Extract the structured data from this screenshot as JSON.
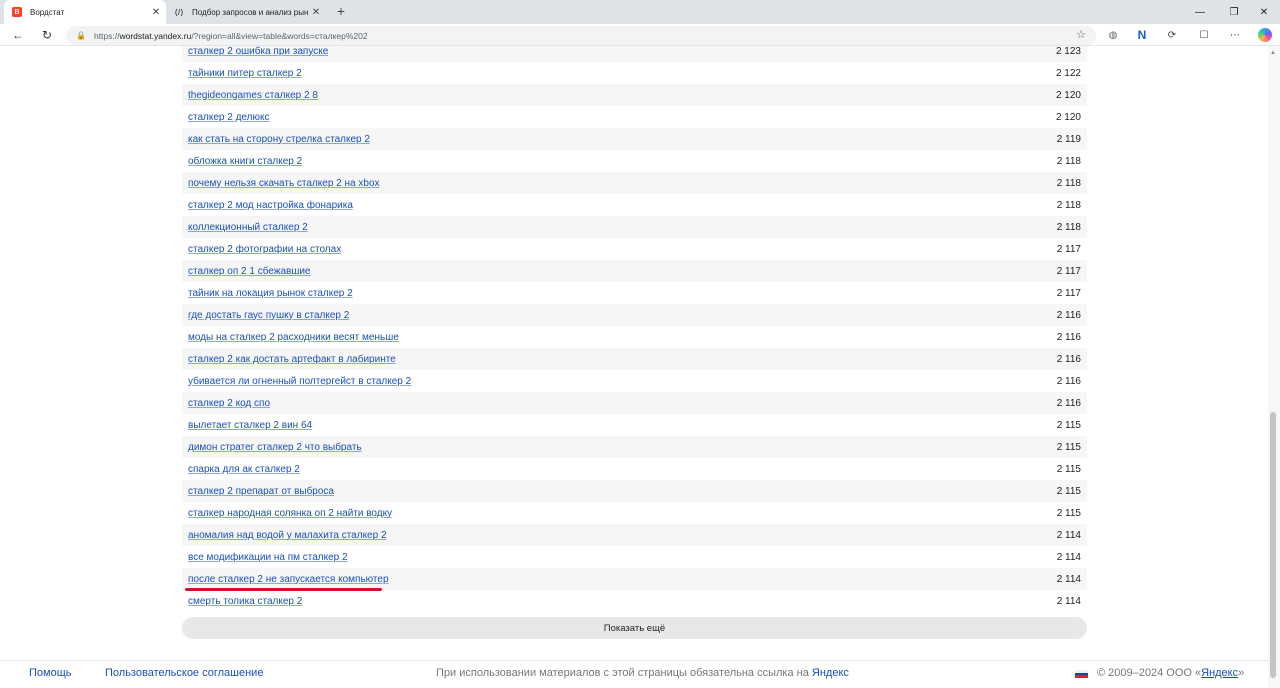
{
  "browser": {
    "tabs": [
      {
        "title": "Вордстат",
        "active": true
      },
      {
        "title": "Подбор запросов и анализ рын"
      }
    ],
    "url_prefix": "https://",
    "url_host": "wordstat.yandex.ru",
    "url_rest": "/?region=all&view=table&words=сталкер%202"
  },
  "rows": [
    {
      "query": "сталкер 2 ошибка при запуске",
      "count": "2 123"
    },
    {
      "query": "тайники питер сталкер 2",
      "count": "2 122"
    },
    {
      "query": "thegideongames сталкер 2 8",
      "count": "2 120"
    },
    {
      "query": "сталкер 2 делюкс",
      "count": "2 120"
    },
    {
      "query": "как стать на сторону стрелка сталкер 2",
      "count": "2 119"
    },
    {
      "query": "обложка книги сталкер 2",
      "count": "2 118"
    },
    {
      "query": "почему нельзя скачать сталкер 2 на xbox",
      "count": "2 118"
    },
    {
      "query": "сталкер 2 мод настройка фонарика",
      "count": "2 118"
    },
    {
      "query": "коллекционный сталкер 2",
      "count": "2 118"
    },
    {
      "query": "сталкер 2 фотографии на столах",
      "count": "2 117"
    },
    {
      "query": "сталкер оп 2 1 сбежавшие",
      "count": "2 117"
    },
    {
      "query": "тайник на локация рынок сталкер 2",
      "count": "2 117"
    },
    {
      "query": "где достать гаус пушку в сталкер 2",
      "count": "2 116"
    },
    {
      "query": "моды на сталкер 2 расходники весят меньше",
      "count": "2 116"
    },
    {
      "query": "сталкер 2 как достать артефакт в лабиринте",
      "count": "2 116"
    },
    {
      "query": "убивается ли огненный полтергейст в сталкер 2",
      "count": "2 116"
    },
    {
      "query": "сталкер 2 код спо",
      "count": "2 116"
    },
    {
      "query": "вылетает сталкер 2 вин 64",
      "count": "2 115"
    },
    {
      "query": "димон стратег сталкер 2 что выбрать",
      "count": "2 115"
    },
    {
      "query": "спарка для ак сталкер 2",
      "count": "2 115"
    },
    {
      "query": "сталкер 2 препарат от выброса",
      "count": "2 115"
    },
    {
      "query": "сталкер народная солянка оп 2 найти водку",
      "count": "2 115"
    },
    {
      "query": "аномалия над водой у малахита сталкер 2",
      "count": "2 114"
    },
    {
      "query": "все модификации на пм сталкер 2",
      "count": "2 114"
    },
    {
      "query": "после сталкер 2 не запускается компьютер",
      "count": "2 114",
      "highlight": true
    },
    {
      "query": "смерть толика сталкер 2",
      "count": "2 114"
    }
  ],
  "show_more_label": "Показать ещё",
  "footer": {
    "help": "Помощь",
    "terms": "Пользовательское соглашение",
    "notice_text": "При использовании материалов с этой страницы обязательна ссылка на ",
    "notice_link": "Яндекс",
    "copyright_prefix": "© 2009–2024  ООО «",
    "copyright_link": "Яндекс",
    "copyright_suffix": "»"
  },
  "colors": {
    "link": "#1a4ec2",
    "highlight_mark": "#d6102b",
    "row_stripe": "#f6f6f6"
  }
}
